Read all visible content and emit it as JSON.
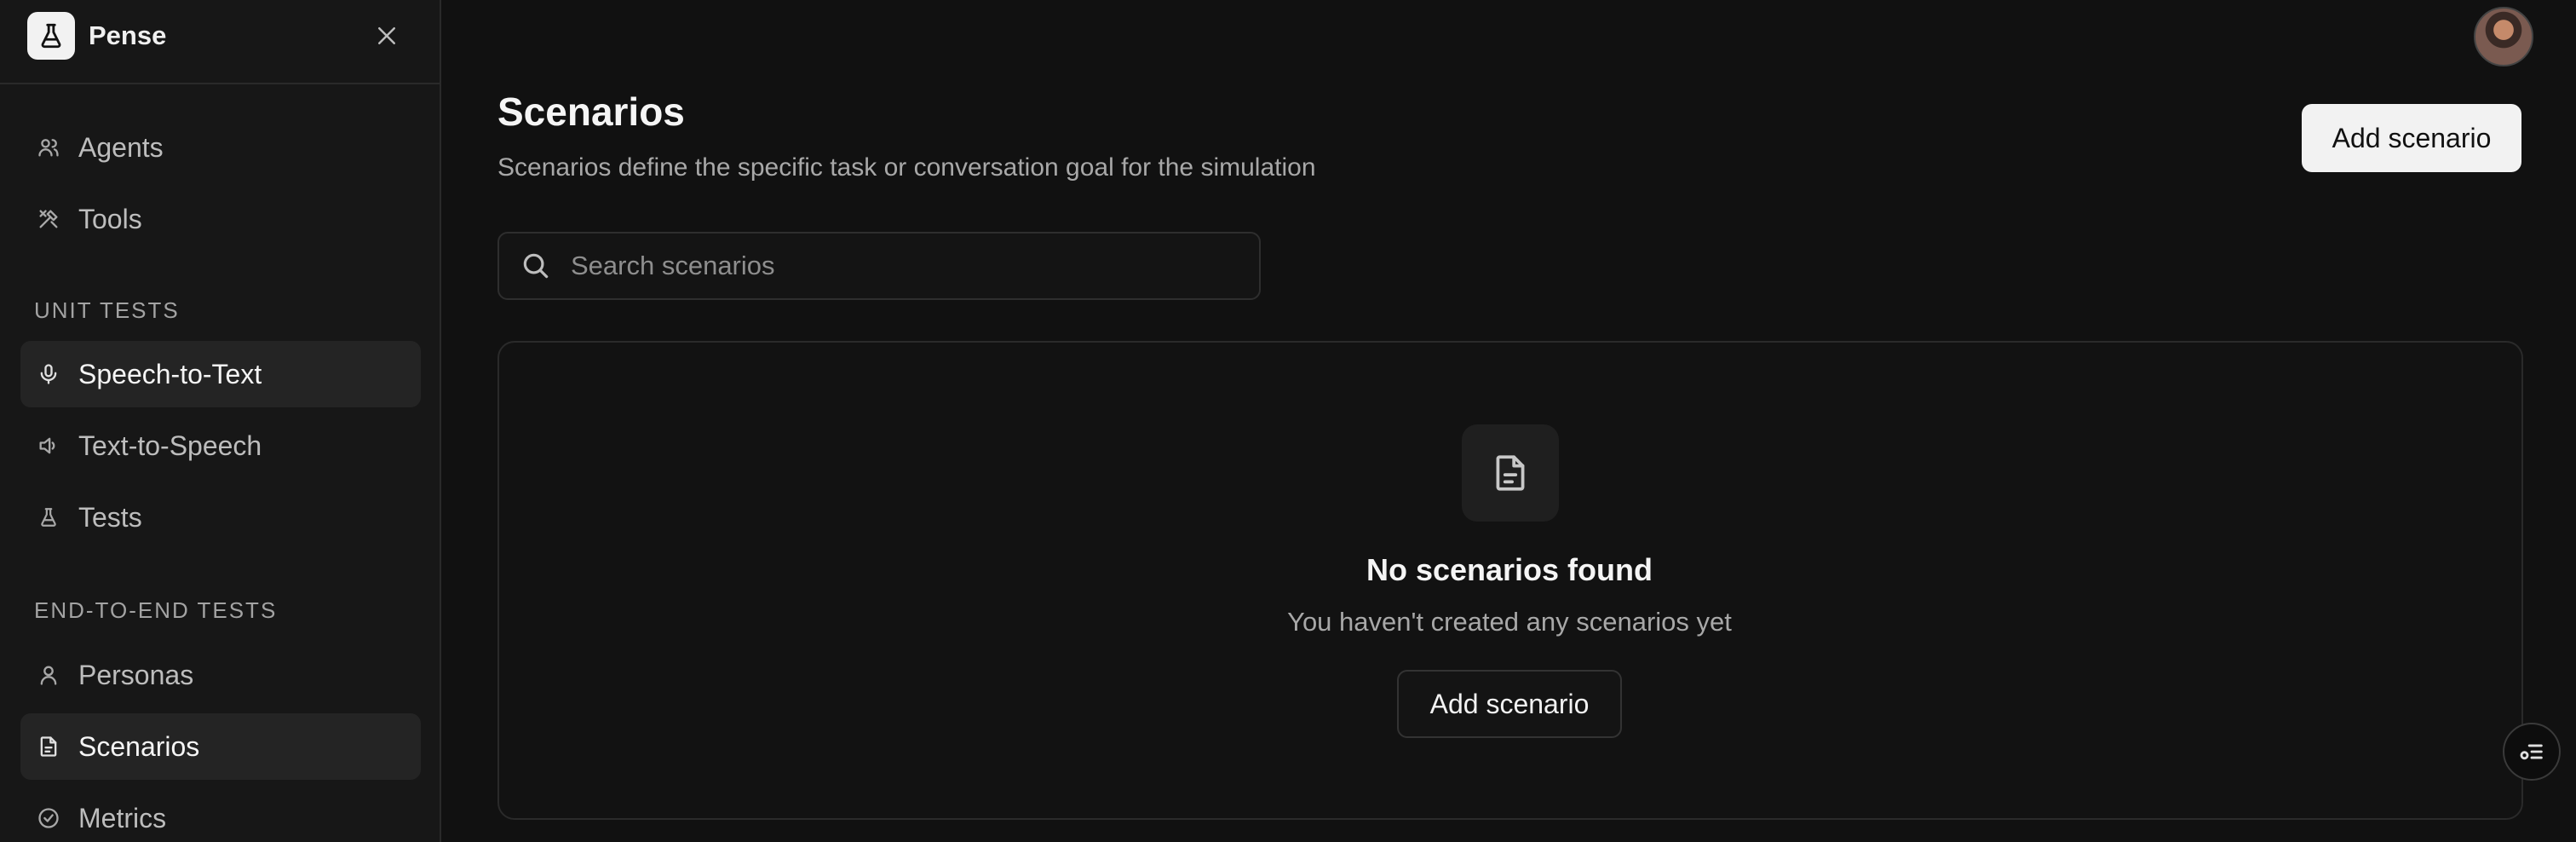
{
  "app": {
    "name": "Pense"
  },
  "sidebar": {
    "items_top": [
      {
        "label": "Agents",
        "icon": "users-icon"
      },
      {
        "label": "Tools",
        "icon": "tools-icon"
      }
    ],
    "sections": [
      {
        "title": "UNIT TESTS",
        "items": [
          {
            "label": "Speech-to-Text",
            "icon": "microphone-icon",
            "active": true
          },
          {
            "label": "Text-to-Speech",
            "icon": "speaker-icon",
            "active": false
          },
          {
            "label": "Tests",
            "icon": "flask-icon",
            "active": false
          }
        ]
      },
      {
        "title": "END-TO-END TESTS",
        "items": [
          {
            "label": "Personas",
            "icon": "user-icon",
            "active": false
          },
          {
            "label": "Scenarios",
            "icon": "document-icon",
            "active": true
          },
          {
            "label": "Metrics",
            "icon": "check-circle-icon",
            "active": false
          }
        ]
      }
    ]
  },
  "header": {
    "title": "Scenarios",
    "subtitle": "Scenarios define the specific task or conversation goal for the simulation",
    "add_button": "Add scenario"
  },
  "search": {
    "placeholder": "Search scenarios",
    "value": ""
  },
  "empty_state": {
    "title": "No scenarios found",
    "subtitle": "You haven't created any scenarios yet",
    "button": "Add scenario"
  },
  "colors": {
    "background": "#111111",
    "sidebar": "#171717",
    "accent": "#f2f2f2"
  }
}
